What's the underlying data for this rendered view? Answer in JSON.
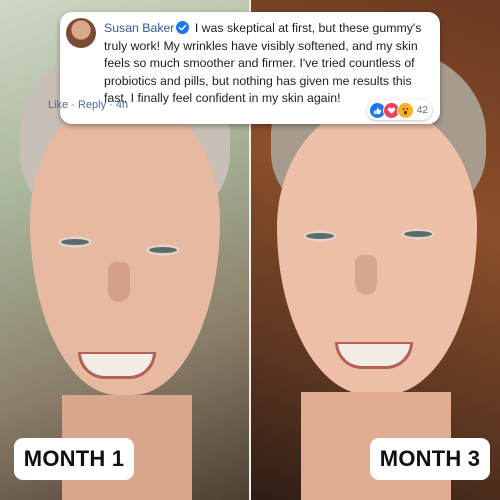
{
  "comment": {
    "author": "Susan Baker",
    "text": "I was skeptical at first, but these gummy's truly work! My wrinkles have visibly softened, and my skin feels so much smoother and firmer. I've tried countless of probiotics and pills, but nothing has given me results this fast. I finally feel confident in my skin again!",
    "like_label": "Like",
    "separator": "·",
    "reply_label": "Reply",
    "time": "4h",
    "reaction_count": "42",
    "reactions": [
      "like-icon",
      "love-icon",
      "wow-icon"
    ]
  },
  "labels": {
    "left": "MONTH 1",
    "right": "MONTH 3"
  },
  "colors": {
    "author": "#385898",
    "verified": "#1877f2",
    "label_bg": "#ffffff"
  }
}
